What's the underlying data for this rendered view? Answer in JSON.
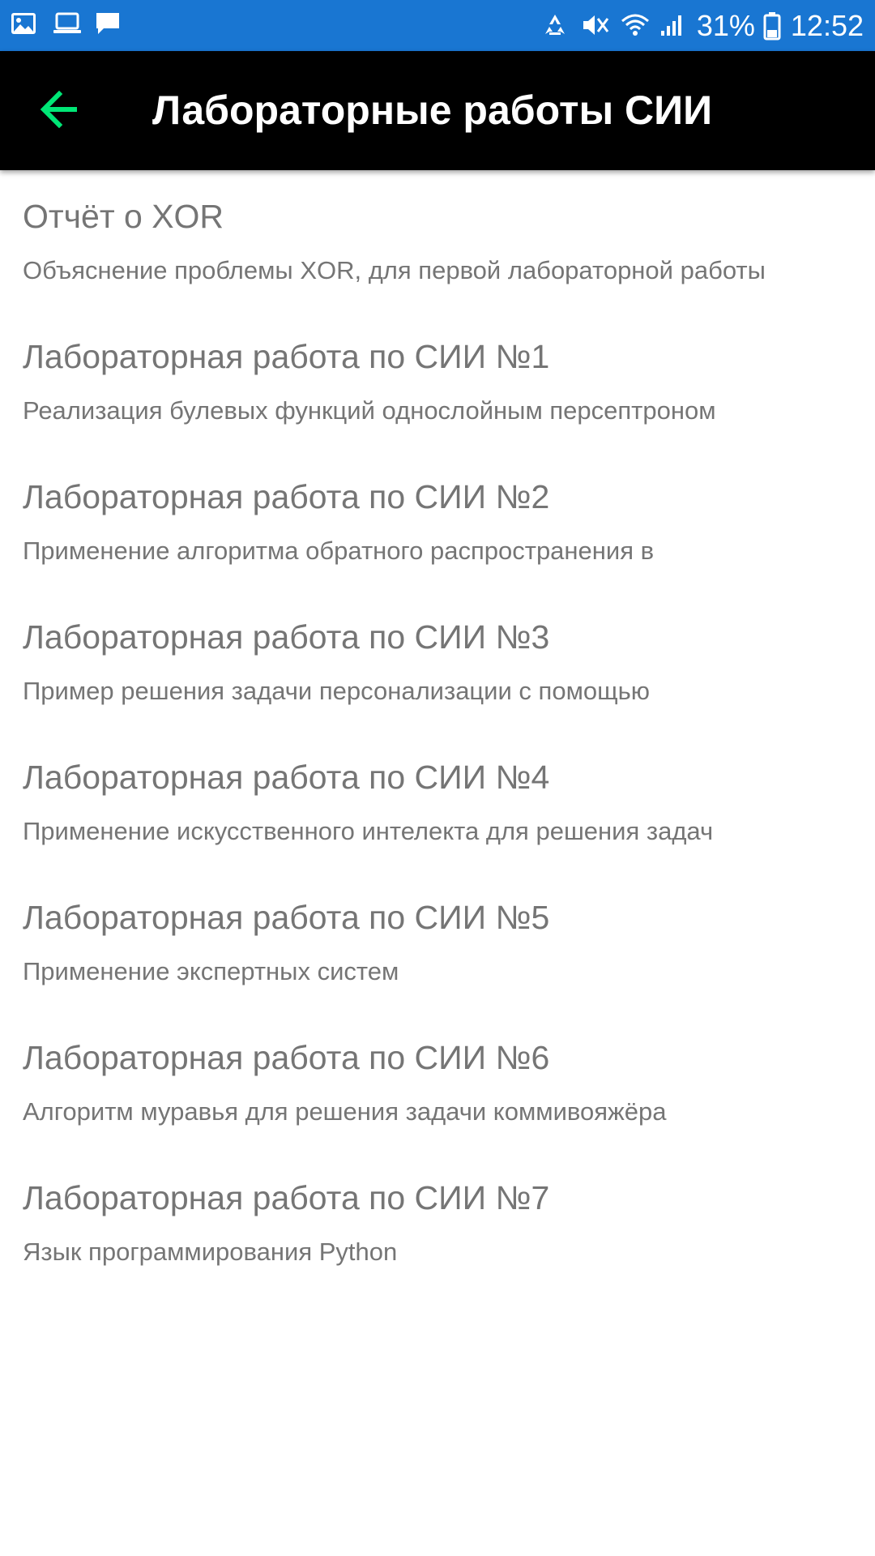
{
  "status_bar": {
    "battery_percent": "31%",
    "time": "12:52",
    "left_icons": [
      "gallery-icon",
      "laptop-icon",
      "message-icon"
    ],
    "right_icons": [
      "recycle-icon",
      "mute-icon",
      "wifi-icon",
      "signal-icon",
      "battery-icon"
    ],
    "background_color": "#1976d2"
  },
  "toolbar": {
    "title": "Лабораторные работы СИИ",
    "back_icon": "arrow-left-icon",
    "back_icon_color": "#00e676",
    "background_color": "#000000"
  },
  "list": {
    "items": [
      {
        "title": "Отчёт о XOR",
        "subtitle": "Объяснение проблемы XOR, для первой лабораторной работы"
      },
      {
        "title": "Лабораторная работа по СИИ №1",
        "subtitle": "Реализация булевых функций однослойным персептроном"
      },
      {
        "title": "Лабораторная работа по СИИ №2",
        "subtitle": "Применение алгоритма обратного распространения в"
      },
      {
        "title": "Лабораторная работа по СИИ №3",
        "subtitle": "Пример решения задачи персонализации с помощью"
      },
      {
        "title": "Лабораторная работа по СИИ №4",
        "subtitle": "Применение искусственного интелекта для решения задач"
      },
      {
        "title": "Лабораторная работа по СИИ №5",
        "subtitle": "Применение экспертных систем"
      },
      {
        "title": "Лабораторная работа по СИИ №6",
        "subtitle": "Алгоритм муравья для решения задачи коммивояжёра"
      },
      {
        "title": "Лабораторная работа по СИИ №7",
        "subtitle": "Язык программирования Python"
      }
    ]
  }
}
